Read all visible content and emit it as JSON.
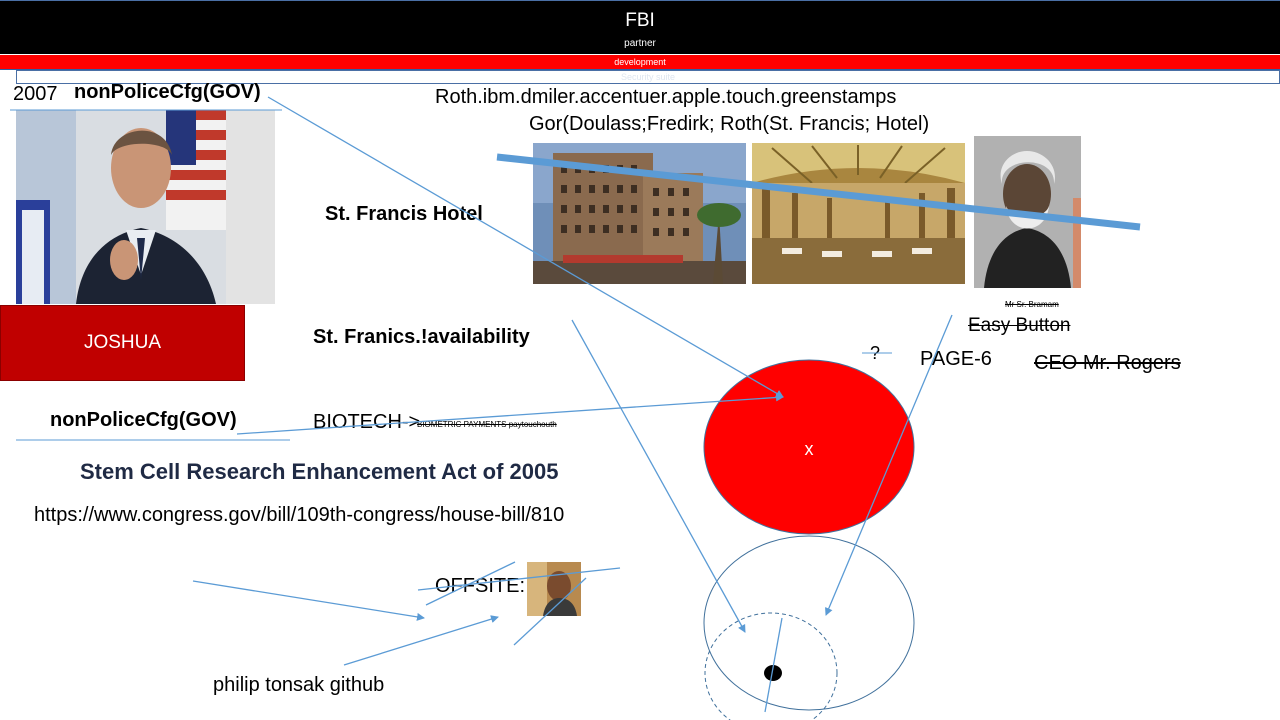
{
  "header": {
    "title": "FBI",
    "subtitle": "partner",
    "strip_label": "development",
    "outline_label": "Security suite"
  },
  "left": {
    "year": "2007",
    "top_cfg": "nonPoliceCfg(GOV)",
    "joshua": "JOSHUA",
    "lower_cfg": "nonPoliceCfg(GOV)"
  },
  "center": {
    "roth_line": "Roth.ibm.dmiler.accentuer.apple.touch.greenstamps",
    "gor_line": "Gor(Doulass;Fredirk; Roth(St. Francis; Hotel)",
    "st_francis_hotel": "St. Francis Hotel",
    "availability": "St. Franics.!availability",
    "biotech": "BIOTECH->",
    "biometric": "BIOMETRIC PAYMENTS paytouchouth",
    "stem_cell": "Stem Cell Research  Enhancement Act of 2005",
    "congress_url": "https://www.congress.gov/bill/109th-congress/house-bill/810",
    "offsite": "OFFSITE:",
    "github": "philip tonsak github"
  },
  "right": {
    "portrait_caption": "Mr Sr. Bramam",
    "easy_button": "Easy Button",
    "question": "?",
    "page6": "PAGE-6",
    "ceo": "CEO Mr. Rogers",
    "circle_mark": "x"
  },
  "colors": {
    "red": "#ff0000",
    "dark_red": "#c00000",
    "line_blue": "#5b9bd5",
    "navy_text": "#1f2a44"
  }
}
